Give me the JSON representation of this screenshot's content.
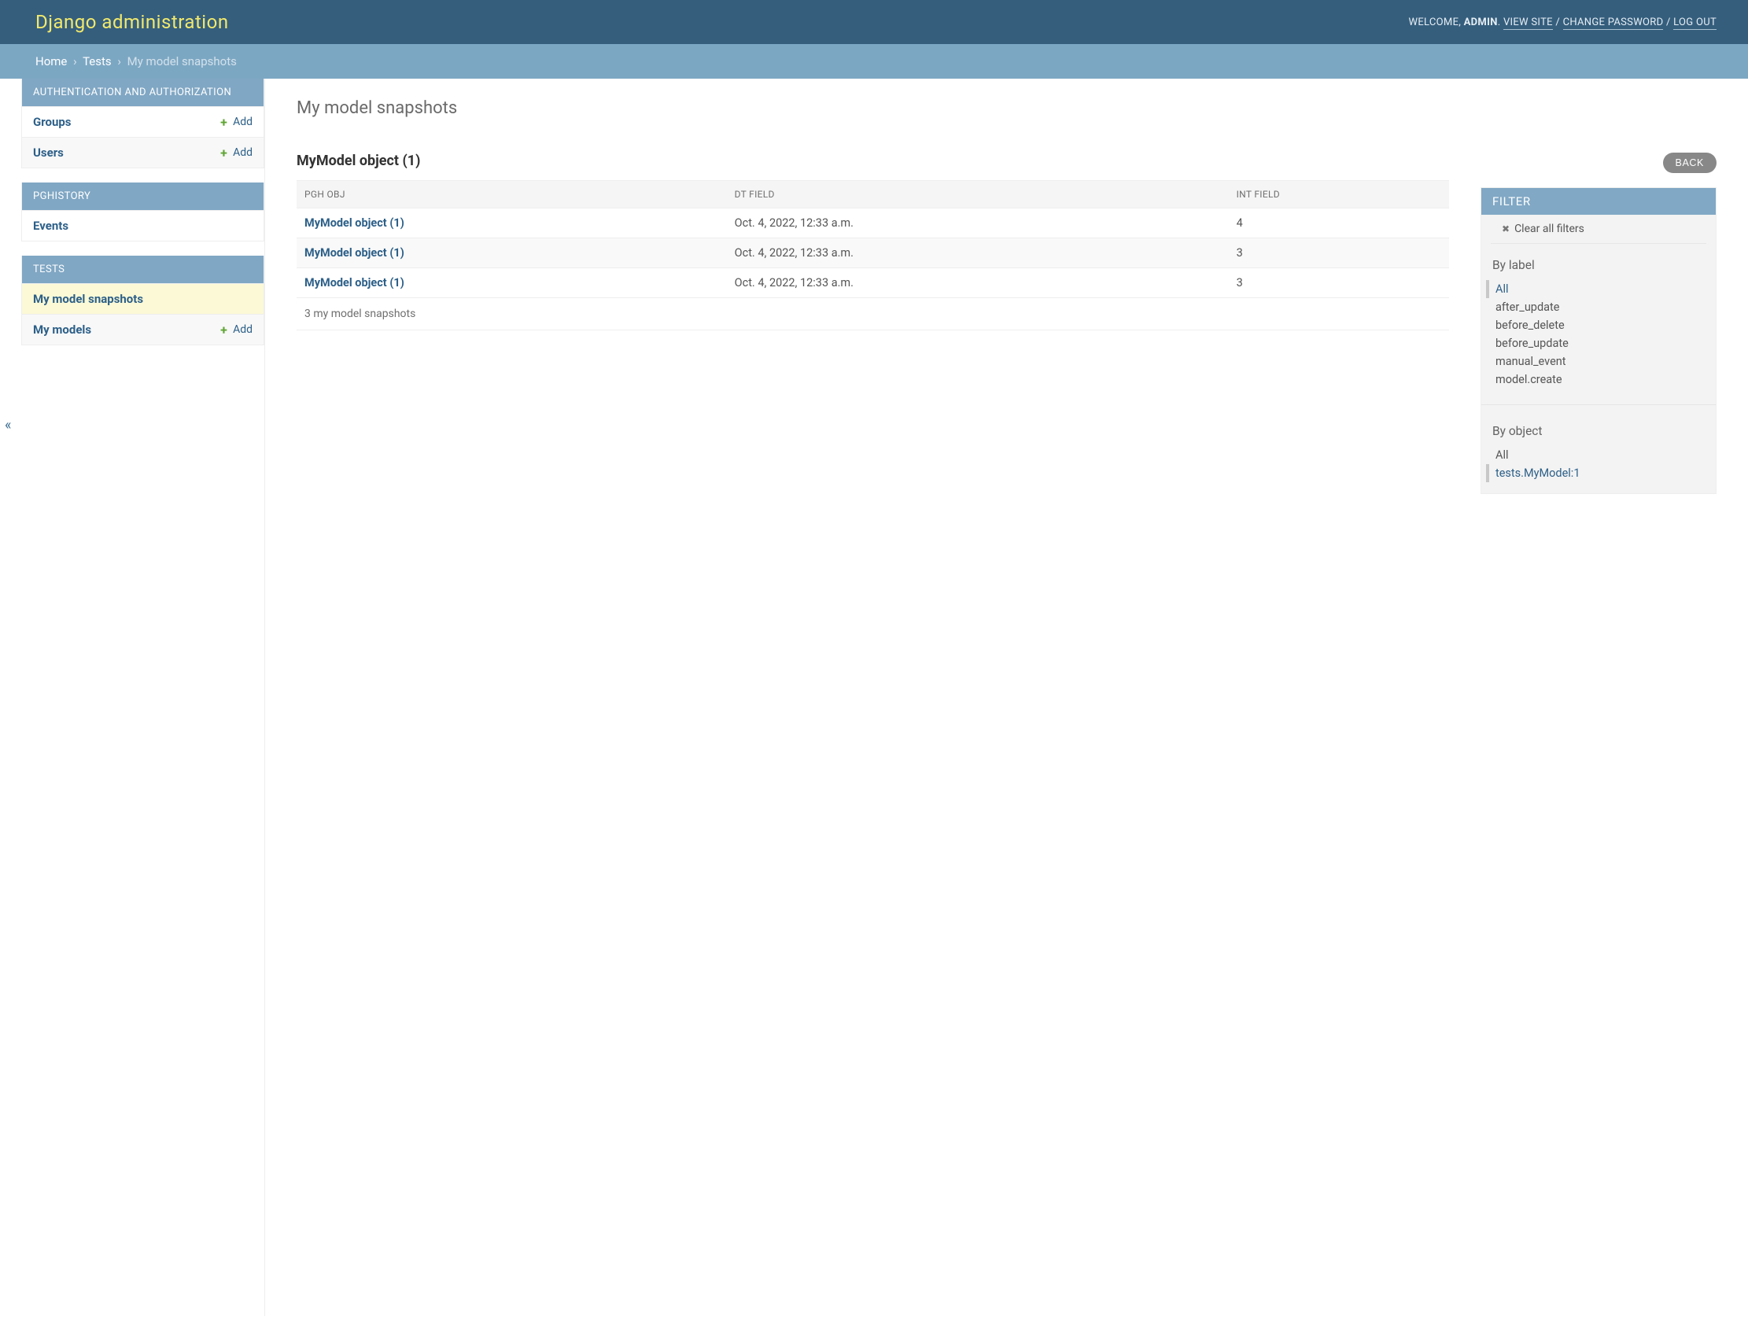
{
  "header": {
    "brand": "Django administration",
    "welcome_prefix": "WELCOME, ",
    "user": "ADMIN",
    "links": {
      "view_site": "VIEW SITE",
      "change_password": "CHANGE PASSWORD",
      "log_out": "LOG OUT"
    }
  },
  "breadcrumb": {
    "home": "Home",
    "app": "Tests",
    "current": "My model snapshots"
  },
  "sidebar": {
    "auth": {
      "caption": "AUTHENTICATION AND AUTHORIZATION",
      "items": [
        {
          "label": "Groups",
          "add": "Add"
        },
        {
          "label": "Users",
          "add": "Add"
        }
      ]
    },
    "pghistory": {
      "caption": "PGHISTORY",
      "items": [
        {
          "label": "Events"
        }
      ]
    },
    "tests": {
      "caption": "TESTS",
      "items": [
        {
          "label": "My model snapshots",
          "active": true
        },
        {
          "label": "My models",
          "add": "Add"
        }
      ]
    }
  },
  "page": {
    "title": "My model snapshots",
    "object_title": "MyModel object (1)",
    "columns": {
      "c0": "PGH OBJ",
      "c1": "DT FIELD",
      "c2": "INT FIELD"
    },
    "rows": [
      {
        "obj": "MyModel object (1)",
        "dt": "Oct. 4, 2022, 12:33 a.m.",
        "int": "4"
      },
      {
        "obj": "MyModel object (1)",
        "dt": "Oct. 4, 2022, 12:33 a.m.",
        "int": "3"
      },
      {
        "obj": "MyModel object (1)",
        "dt": "Oct. 4, 2022, 12:33 a.m.",
        "int": "3"
      }
    ],
    "result_count": "3 my model snapshots"
  },
  "right": {
    "back": "BACK",
    "filter_title": "FILTER",
    "clear": "Clear all filters",
    "by_label": {
      "heading": "By label",
      "items": [
        "All",
        "after_update",
        "before_delete",
        "before_update",
        "manual_event",
        "model.create"
      ],
      "selected": "All"
    },
    "by_object": {
      "heading": "By object",
      "items": [
        "All",
        "tests.MyModel:1"
      ],
      "selected": "tests.MyModel:1"
    }
  }
}
